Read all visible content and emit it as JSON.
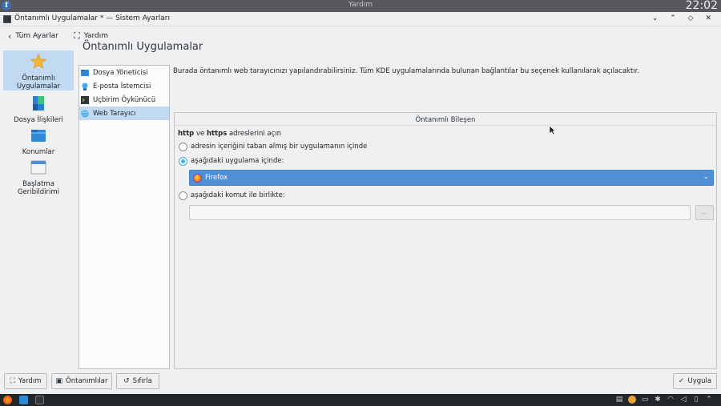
{
  "topbar": {
    "center_text": "Yardım",
    "clock": "22:02"
  },
  "window": {
    "title": "Öntanımlı Uygulamalar * — Sistem Ayarları",
    "controls": [
      "⌄",
      "⌃",
      "◇",
      "✕"
    ]
  },
  "toolbar": {
    "back_label": "Tüm Ayarlar",
    "help_label": "Yardım"
  },
  "categories": [
    {
      "label": "Öntanımlı Uygulamalar",
      "icon": "star-icon",
      "selected": true
    },
    {
      "label": "Dosya İlişkileri",
      "icon": "file-associations-icon",
      "selected": false
    },
    {
      "label": "Konumlar",
      "icon": "folder-icon",
      "selected": false
    },
    {
      "label": "Başlatma Geribildirimi",
      "icon": "launch-feedback-icon",
      "selected": false
    }
  ],
  "page_title": "Öntanımlı Uygulamalar",
  "list": [
    {
      "label": "Dosya Yöneticisi",
      "icon": "folder-icon",
      "selected": false
    },
    {
      "label": "E-posta İstemcisi",
      "icon": "email-icon",
      "selected": false
    },
    {
      "label": "Uçbirim Öykünücü",
      "icon": "terminal-icon",
      "selected": false
    },
    {
      "label": "Web Tarayıcı",
      "icon": "web-browser-icon",
      "selected": true
    }
  ],
  "description": "Burada öntanımlı web tarayıcınızı yapılandırabilirsiniz. Tüm KDE uygulamalarında bulunan bağlantılar bu seçenek kullanılarak açılacaktır.",
  "group": {
    "title": "Öntanımlı Bileşen",
    "heading_bold1": "http",
    "heading_mid": "ve",
    "heading_bold2": "https",
    "heading_rest": "adreslerini açın",
    "option1": "adresin içeriğini taban almış bir uygulamanın içinde",
    "option2": "aşağıdaki uygulama içinde:",
    "option3": "aşağıdaki komut ile birlikte:",
    "selected_app": "Firefox",
    "command_value": "",
    "browse_label": "..."
  },
  "buttons": {
    "help": "Yardım",
    "defaults": "Öntanımlılar",
    "reset": "Sıfırla",
    "apply": "Uygula"
  },
  "colors": {
    "selection": "#c2d9f2",
    "accent": "#3daee9",
    "combo": "#4f8fd6"
  }
}
